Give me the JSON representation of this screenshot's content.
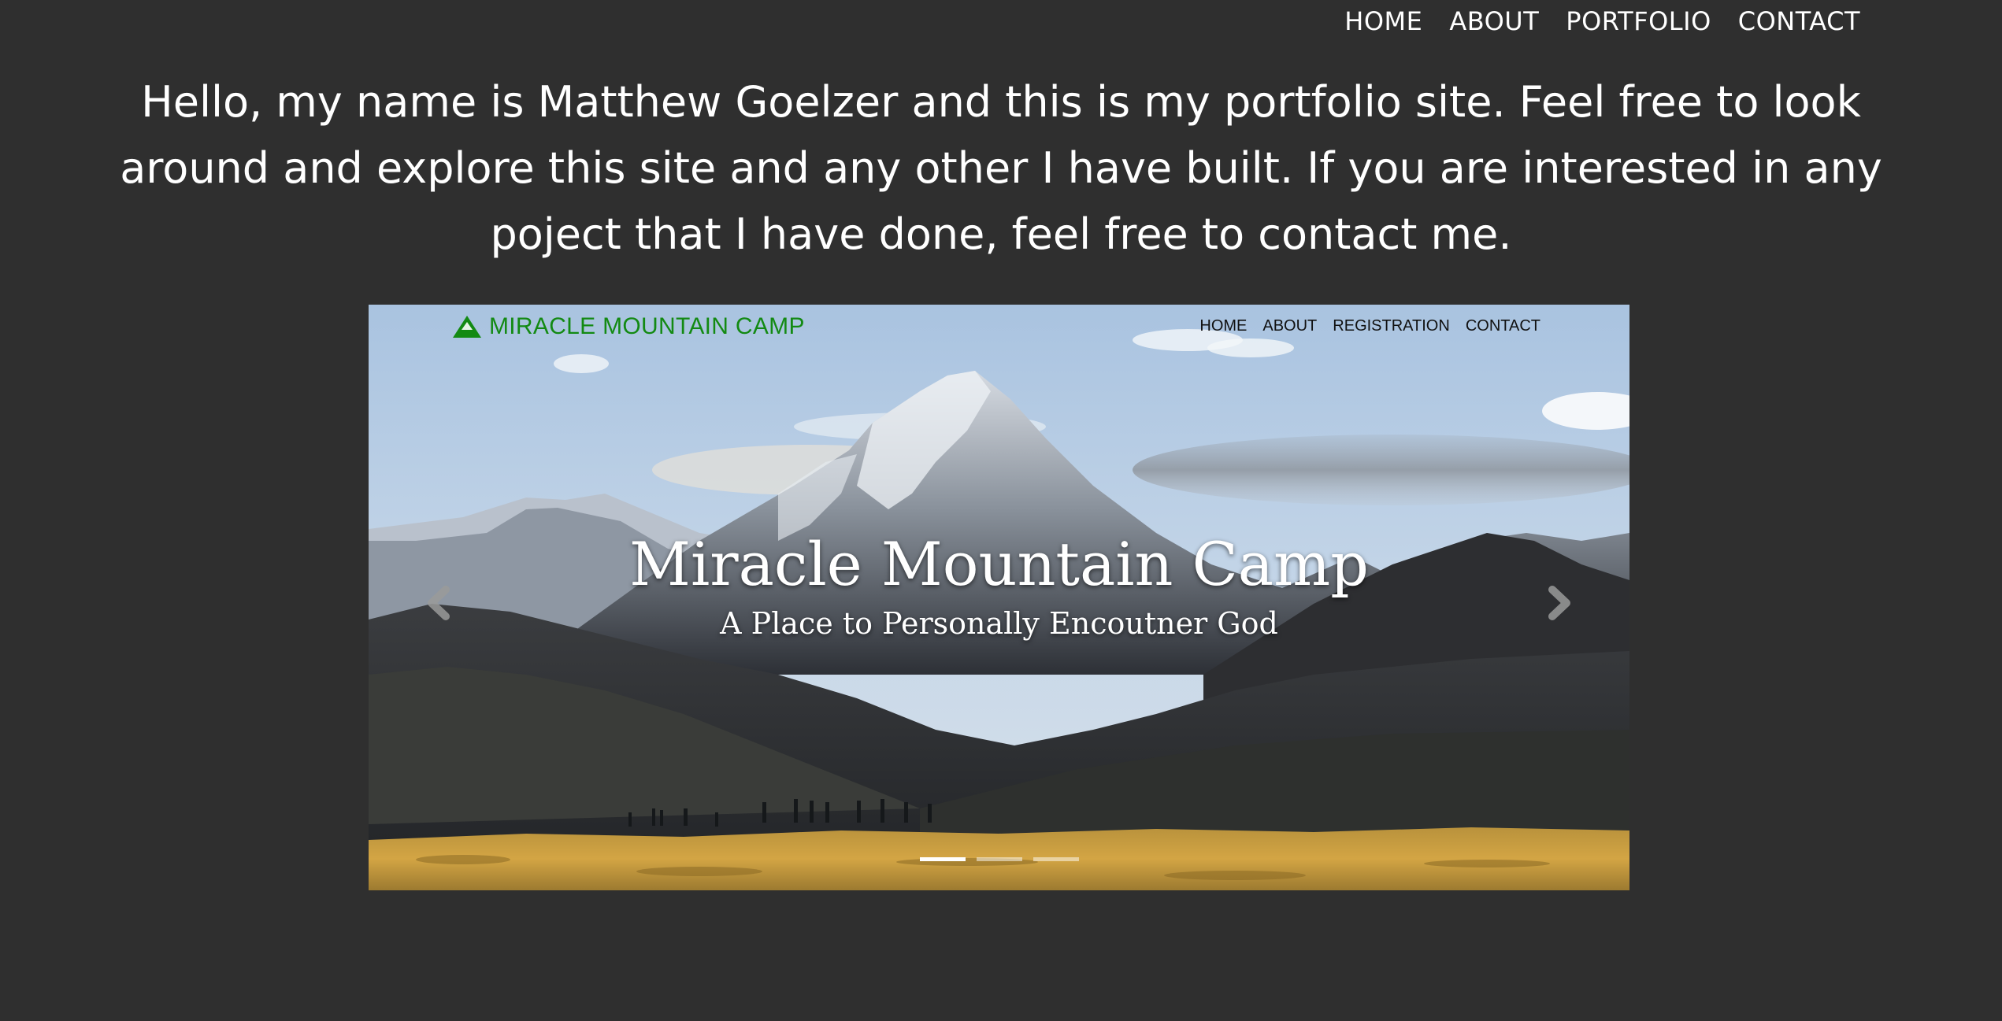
{
  "site_nav": {
    "items": [
      {
        "label": "HOME"
      },
      {
        "label": "ABOUT"
      },
      {
        "label": "PORTFOLIO"
      },
      {
        "label": "CONTACT"
      }
    ]
  },
  "intro": {
    "text": "Hello, my name is Matthew Goelzer and this is my portfolio site. Feel free to look around and explore this site and any other I have built. If you are interested in any poject that I have done, feel free to contact me."
  },
  "preview": {
    "logo_text": "MIRACLE MOUNTAIN CAMP",
    "logo_color": "#138a13",
    "nav": [
      {
        "label": "HOME"
      },
      {
        "label": "ABOUT"
      },
      {
        "label": "REGISTRATION"
      },
      {
        "label": "CONTACT"
      }
    ],
    "hero_title": "Miracle Mountain Camp",
    "hero_subtitle": "A Place to Personally Encoutner God",
    "carousel": {
      "slide_count": 3,
      "active_slide": 1,
      "prev_icon": "chevron-left-icon",
      "next_icon": "chevron-right-icon"
    }
  },
  "colors": {
    "page_background": "#2f2f2f",
    "text": "#ffffff"
  }
}
